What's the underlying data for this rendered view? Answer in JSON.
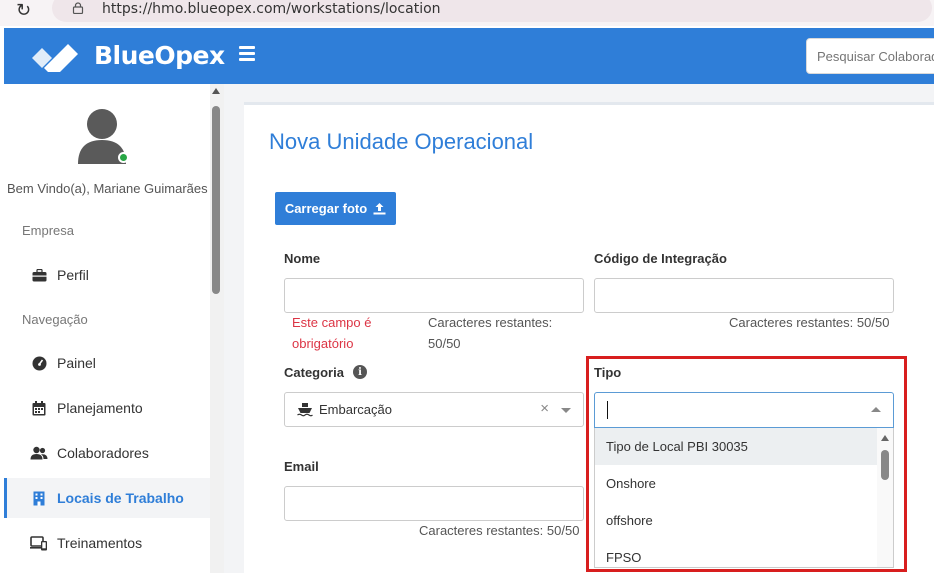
{
  "browser": {
    "url": "https://hmo.blueopex.com/workstations/location"
  },
  "header": {
    "brand": "BlueOpex",
    "search_placeholder": "Pesquisar Colaborador"
  },
  "sidebar": {
    "welcome": "Bem Vindo(a), Mariane Guimarães",
    "section_empresa": "Empresa",
    "section_navegacao": "Navegação",
    "items": [
      {
        "label": "Perfil",
        "icon": "briefcase-icon"
      },
      {
        "label": "Painel",
        "icon": "dashboard-icon"
      },
      {
        "label": "Planejamento",
        "icon": "calendar-icon"
      },
      {
        "label": "Colaboradores",
        "icon": "users-icon"
      },
      {
        "label": "Locais de Trabalho",
        "icon": "building-icon",
        "active": true
      },
      {
        "label": "Treinamentos",
        "icon": "training-icon"
      }
    ]
  },
  "form": {
    "title": "Nova Unidade Operacional",
    "upload_label": "Carregar foto",
    "nome": {
      "label": "Nome",
      "value": "",
      "error": "Este campo é obrigatório",
      "remaining_label": "Caracteres restantes:",
      "remaining_value": "50/50"
    },
    "codigo": {
      "label": "Código de Integração",
      "value": "",
      "remaining": "Caracteres restantes: 50/50"
    },
    "categoria": {
      "label": "Categoria",
      "value": "Embarcação"
    },
    "tipo": {
      "label": "Tipo",
      "value": "",
      "options": [
        "Tipo de Local PBI 30035",
        "Onshore",
        "offshore",
        "FPSO"
      ],
      "highlighted": "Tipo de Local PBI 30035"
    },
    "email": {
      "label": "Email",
      "value": "",
      "remaining": "Caracteres restantes: 50/50"
    }
  },
  "colors": {
    "primary": "#2f7ed8",
    "error": "#dc3545",
    "annotation": "#d81e1e"
  }
}
